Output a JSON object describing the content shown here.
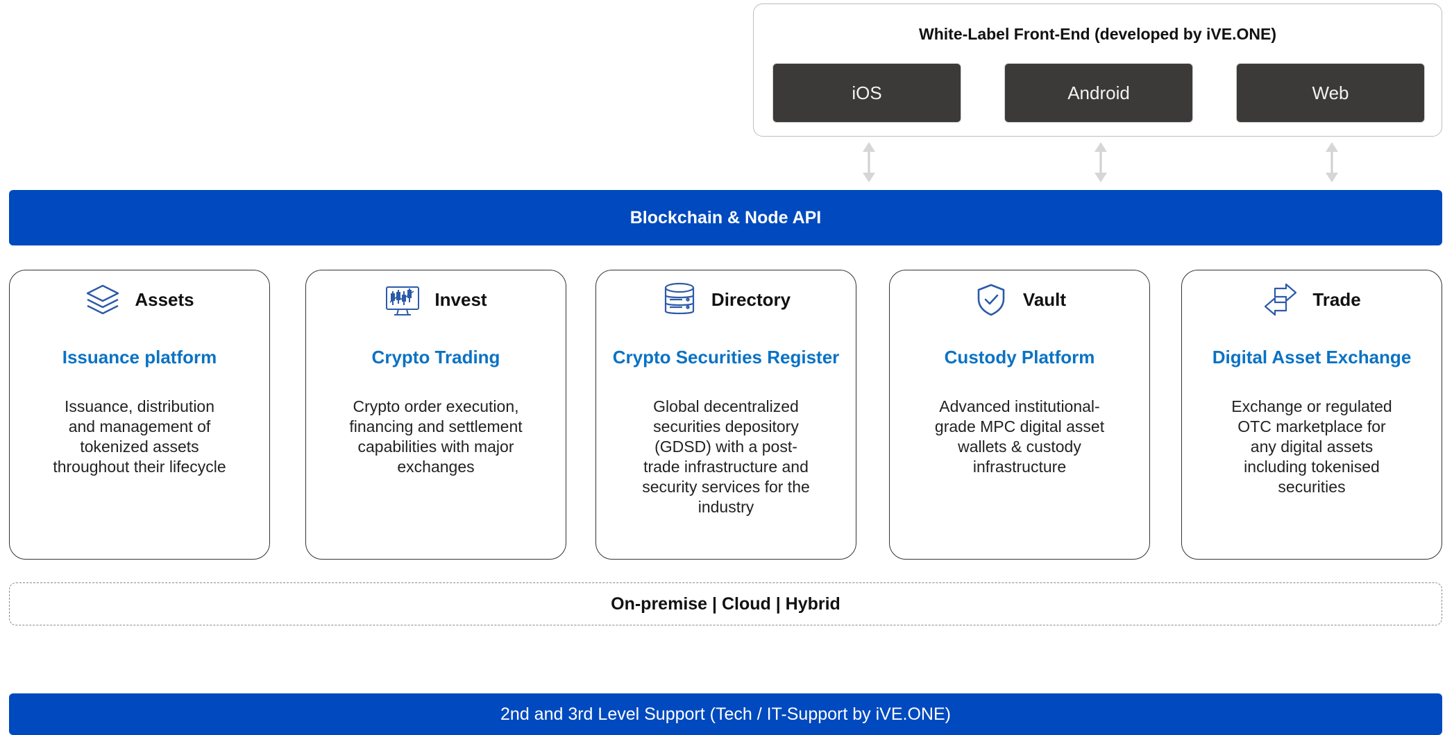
{
  "frontend": {
    "title": "White-Label Front-End (developed by iVE.ONE)",
    "platforms": [
      "iOS",
      "Android",
      "Web"
    ]
  },
  "api_bar": {
    "label": "Blockchain & Node API"
  },
  "modules": [
    {
      "name": "Assets",
      "icon": "layers-icon",
      "subtitle": "Issuance platform",
      "description": "Issuance, distribution and management of tokenized assets throughout their lifecycle"
    },
    {
      "name": "Invest",
      "icon": "trading-monitor-icon",
      "subtitle": "Crypto Trading",
      "description": "Crypto order execution, financing and settlement capabilities with major exchanges"
    },
    {
      "name": "Directory",
      "icon": "database-icon",
      "subtitle": "Crypto Securities Register",
      "description": "Global decentralized securities depository (GDSD) with a post-trade infrastructure and security services for the industry"
    },
    {
      "name": "Vault",
      "icon": "shield-check-icon",
      "subtitle": "Custody Platform",
      "description": "Advanced institutional-grade MPC digital asset wallets & custody infrastructure"
    },
    {
      "name": "Trade",
      "icon": "exchange-arrows-icon",
      "subtitle": "Digital Asset Exchange",
      "description": "Exchange or regulated OTC marketplace for any digital assets including tokenised securities"
    }
  ],
  "deployment": {
    "label": "On-premise | Cloud | Hybrid"
  },
  "support_bar": {
    "label": "2nd and 3rd Level Support (Tech / IT-Support by iVE.ONE)"
  },
  "colors": {
    "brand_blue": "#0049be",
    "subtitle_blue": "#0a72c4",
    "platform_button": "#3b3a39",
    "icon_blue": "#2c5aa8"
  }
}
